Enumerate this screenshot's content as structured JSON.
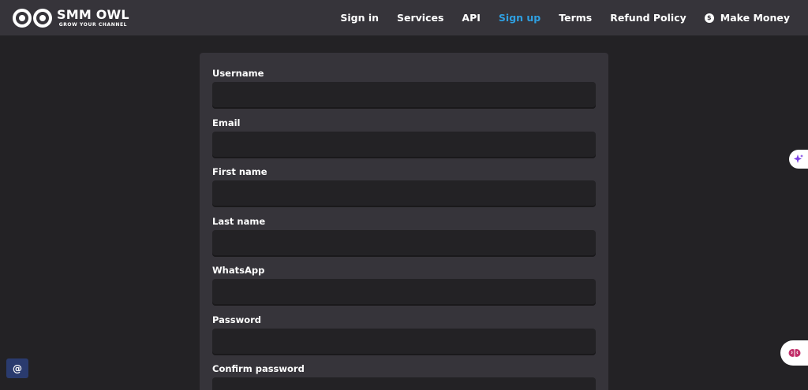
{
  "brand": {
    "title": "SMM OWL",
    "tagline": "GROW YOUR CHANNEL"
  },
  "nav": {
    "links": [
      {
        "label": "Sign in",
        "active": false
      },
      {
        "label": "Services",
        "active": false
      },
      {
        "label": "API",
        "active": false
      },
      {
        "label": "Sign up",
        "active": true
      },
      {
        "label": "Terms",
        "active": false
      },
      {
        "label": "Refund Policy",
        "active": false
      },
      {
        "label": "Make Money",
        "active": false,
        "icon": "dollar-coin-icon"
      }
    ]
  },
  "form": {
    "fields": [
      {
        "label": "Username",
        "value": "",
        "placeholder": ""
      },
      {
        "label": "Email",
        "value": "",
        "placeholder": ""
      },
      {
        "label": "First name",
        "value": "",
        "placeholder": ""
      },
      {
        "label": "Last name",
        "value": "",
        "placeholder": ""
      },
      {
        "label": "WhatsApp",
        "value": "",
        "placeholder": ""
      },
      {
        "label": "Password",
        "value": "",
        "placeholder": ""
      },
      {
        "label": "Confirm password",
        "value": "",
        "placeholder": ""
      }
    ]
  },
  "widgets": {
    "sparkle_icon": "sparkle-icon",
    "brain_icon": "brain-icon",
    "at_icon": "@"
  },
  "colors": {
    "background": "#232225",
    "navbar": "#36343a",
    "card": "#36343a",
    "input": "#232225",
    "accent": "#2f9fe0",
    "sparkle": "#7b3fe4",
    "brain": "#c2306a",
    "chat_button": "#2a3b6e"
  }
}
